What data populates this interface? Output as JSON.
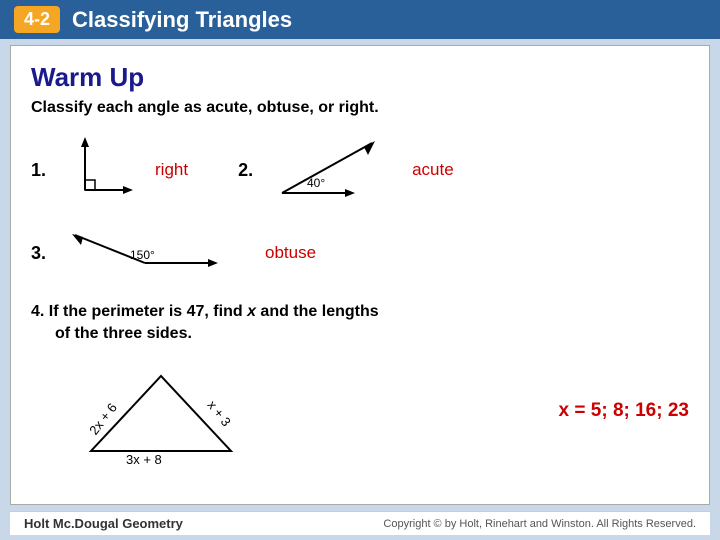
{
  "header": {
    "badge": "4-2",
    "title": "Classifying Triangles"
  },
  "warmUp": {
    "title": "Warm Up",
    "instruction": "Classify each angle as acute, obtuse, or right.",
    "exercises": [
      {
        "number": "1.",
        "answer": "right"
      },
      {
        "number": "2.",
        "angle_label": "40°",
        "answer": "acute"
      },
      {
        "number": "3.",
        "angle_label": "150°",
        "answer": "obtuse"
      }
    ],
    "exercise4": {
      "number": "4.",
      "text": "If the perimeter is 47, find",
      "variable": "x",
      "text2": "and the lengths",
      "text3": "of the three sides.",
      "sides": [
        "2x + 6",
        "x + 3",
        "3x + 8"
      ],
      "answer": "x = 5; 8; 16; 23"
    }
  },
  "footer": {
    "left": "Holt Mc.Dougal Geometry",
    "right": "Copyright © by Holt, Rinehart and Winston. All Rights Reserved."
  }
}
